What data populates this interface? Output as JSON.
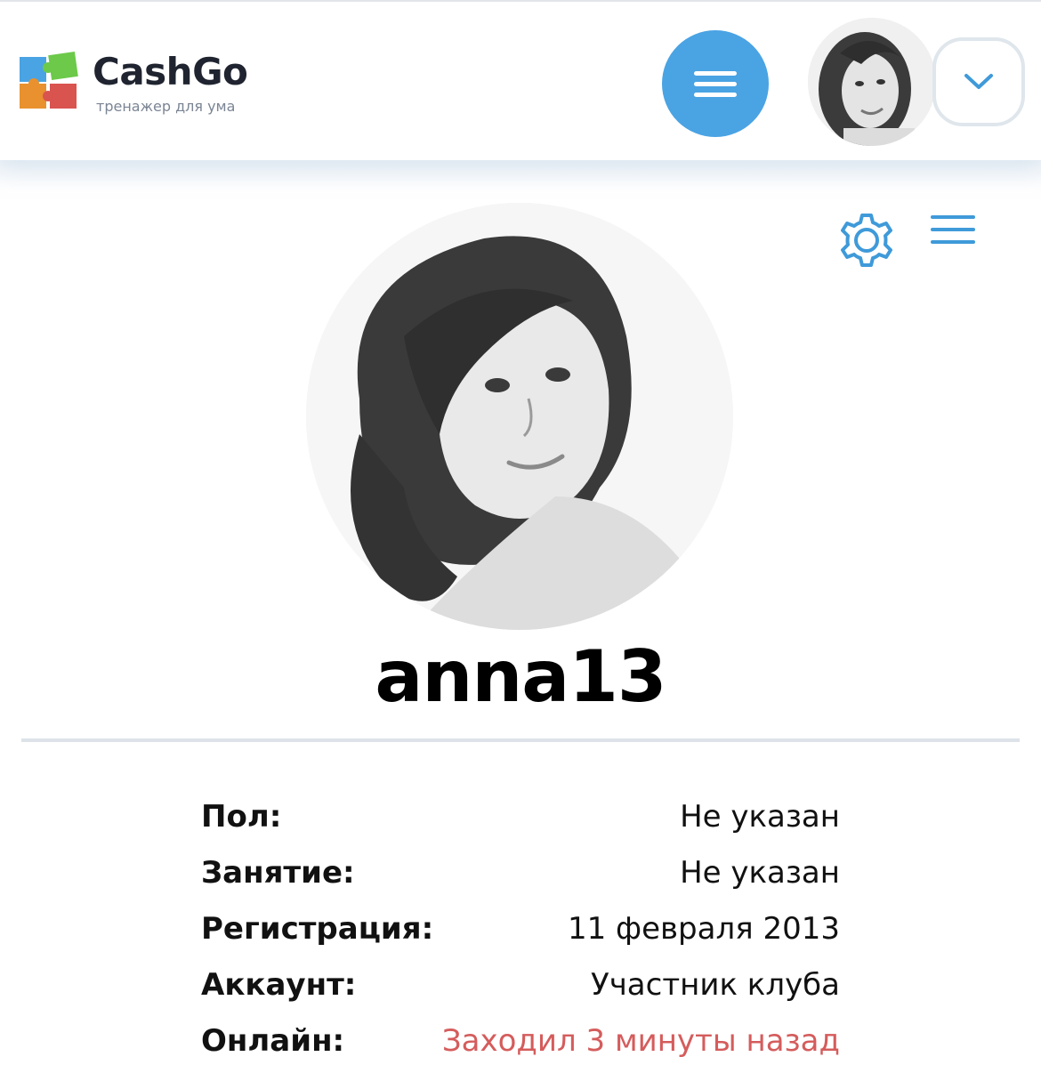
{
  "header": {
    "brand": {
      "title": "CashGo",
      "subtitle": "тренажер для ума",
      "logo_colors": [
        "#4aa3e3",
        "#6cc94a",
        "#e8912e",
        "#d9534f"
      ]
    },
    "menu_icon": "hamburger-icon",
    "dropdown_icon": "chevron-down-icon",
    "accent_color": "#4aa3e3"
  },
  "profile": {
    "username": "anna13",
    "actions": {
      "settings_icon": "gear-icon",
      "list_icon": "list-icon"
    },
    "fields": [
      {
        "label": "Пол:",
        "value": "Не указан"
      },
      {
        "label": "Занятие:",
        "value": "Не указан"
      },
      {
        "label": "Регистрация:",
        "value": "11 февраля 2013"
      },
      {
        "label": "Аккаунт:",
        "value": "Участник клуба"
      },
      {
        "label": "Онлайн:",
        "value": "Заходил 3 минуты назад",
        "color": "#d55c5c"
      }
    ]
  }
}
